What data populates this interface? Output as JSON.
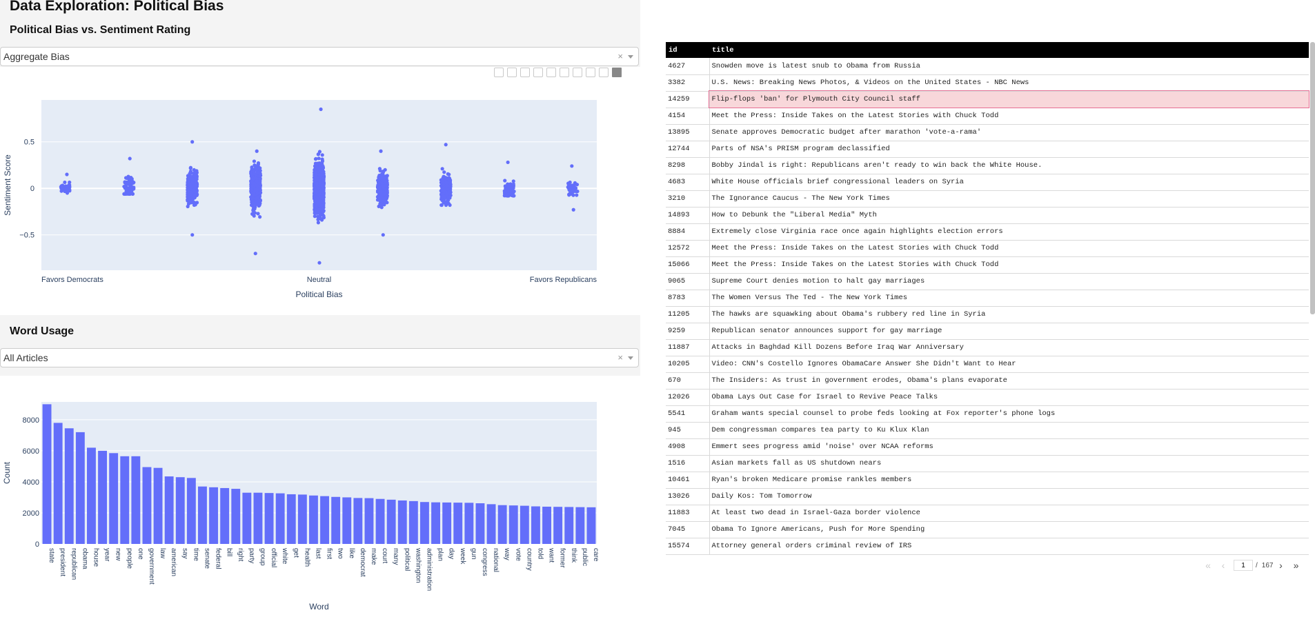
{
  "page_title": "Data Exploration: Political Bias",
  "section1_title": "Political Bias vs. Sentiment Rating",
  "section2_title": "Word Usage",
  "dropdown1": {
    "value": "Aggregate Bias",
    "clear": "×"
  },
  "dropdown2": {
    "value": "All Articles",
    "clear": "×"
  },
  "colors": {
    "marker": "#636efa",
    "plot_bg": "#e5ecf6",
    "header_bg": "#000000",
    "selected_row": "#f8d7da"
  },
  "chart_data": [
    {
      "type": "scatter",
      "title": "",
      "xlabel": "Political Bias",
      "ylabel": "Sentiment Score",
      "x_ticks": [
        "Favors Democrats",
        "Neutral",
        "Favors Republicans"
      ],
      "y_ticks": [
        "0.5",
        "0",
        "−0.5"
      ],
      "ylim": [
        -0.88,
        0.95
      ],
      "grid": true,
      "x_category_count": 9,
      "series": [
        {
          "values": [
            [
              0,
              -0.05,
              0.15
            ],
            [
              1,
              -0.06,
              0.32
            ],
            [
              2,
              -0.5,
              0.5
            ],
            [
              3,
              -0.7,
              0.4
            ],
            [
              4,
              -0.8,
              0.85
            ],
            [
              5,
              -0.5,
              0.4
            ],
            [
              6,
              -0.18,
              0.47
            ],
            [
              7,
              -0.08,
              0.28
            ],
            [
              8,
              -0.23,
              0.24
            ]
          ]
        }
      ]
    },
    {
      "type": "bar",
      "title": "",
      "xlabel": "Word",
      "ylabel": "Count",
      "y_ticks": [
        "0",
        "2000",
        "4000",
        "6000",
        "8000"
      ],
      "ylim": [
        0,
        9150
      ],
      "grid": true,
      "categories": [
        "state",
        "president",
        "republican",
        "obama",
        "house",
        "year",
        "new",
        "people",
        "one",
        "government",
        "law",
        "american",
        "say",
        "time",
        "senate",
        "federal",
        "bill",
        "right",
        "party",
        "group",
        "official",
        "white",
        "get",
        "health",
        "last",
        "first",
        "two",
        "like",
        "democrat",
        "make",
        "court",
        "many",
        "political",
        "washington",
        "administration",
        "plan",
        "day",
        "week",
        "gun",
        "congress",
        "national",
        "way",
        "vote",
        "country",
        "told",
        "want",
        "former",
        "think",
        "public",
        "care"
      ],
      "values": [
        9000,
        7800,
        7450,
        7200,
        6200,
        6000,
        5850,
        5650,
        5650,
        4950,
        4900,
        4350,
        4300,
        4250,
        3700,
        3650,
        3600,
        3550,
        3300,
        3300,
        3280,
        3260,
        3200,
        3180,
        3120,
        3080,
        3030,
        3000,
        2960,
        2950,
        2900,
        2850,
        2800,
        2760,
        2700,
        2680,
        2670,
        2660,
        2650,
        2620,
        2560,
        2500,
        2480,
        2460,
        2420,
        2400,
        2390,
        2380,
        2370,
        2360
      ]
    }
  ],
  "table": {
    "columns": [
      "id",
      "title"
    ],
    "rows": [
      [
        "4627",
        "Snowden move is latest snub to Obama from Russia"
      ],
      [
        "3382",
        "U.S. News: Breaking News Photos, & Videos on the United States - NBC News"
      ],
      [
        "14259",
        "Flip-flops 'ban' for Plymouth City Council staff"
      ],
      [
        "4154",
        "Meet the Press: Inside Takes on the Latest Stories with Chuck Todd"
      ],
      [
        "13895",
        "Senate approves Democratic budget after marathon 'vote-a-rama'"
      ],
      [
        "12744",
        "Parts of NSA's PRISM program declassified"
      ],
      [
        "8298",
        "Bobby Jindal is right: Republicans aren't ready to win back the White House."
      ],
      [
        "4683",
        "White House officials brief congressional leaders on Syria"
      ],
      [
        "3210",
        "The Ignorance Caucus - The New York Times"
      ],
      [
        "14893",
        "How to Debunk the \"Liberal Media\" Myth"
      ],
      [
        "8884",
        "Extremely close Virginia race once again highlights election errors"
      ],
      [
        "12572",
        "Meet the Press: Inside Takes on the Latest Stories with Chuck Todd"
      ],
      [
        "15066",
        "Meet the Press: Inside Takes on the Latest Stories with Chuck Todd"
      ],
      [
        "9065",
        "Supreme Court denies motion to halt gay marriages"
      ],
      [
        "8783",
        "The Women Versus The Ted - The New York Times"
      ],
      [
        "11205",
        "The hawks are squawking about Obama's rubbery red line in Syria"
      ],
      [
        "9259",
        "Republican senator announces support for gay marriage"
      ],
      [
        "11887",
        "Attacks in Baghdad Kill Dozens Before Iraq War Anniversary"
      ],
      [
        "10205",
        "Video: CNN's Costello Ignores ObamaCare Answer She Didn't Want to Hear"
      ],
      [
        "670",
        "The Insiders: As trust in government erodes, Obama's plans evaporate"
      ],
      [
        "12026",
        "Obama Lays Out Case for Israel to Revive Peace Talks"
      ],
      [
        "5541",
        "Graham wants special counsel to probe feds looking at Fox reporter's phone logs"
      ],
      [
        "945",
        "Dem congressman compares tea party to Ku Klux Klan"
      ],
      [
        "4908",
        "Emmert sees progress amid 'noise' over NCAA reforms"
      ],
      [
        "1516",
        "Asian markets fall as US shutdown nears"
      ],
      [
        "10461",
        "Ryan's broken Medicare promise rankles members"
      ],
      [
        "13026",
        "Daily Kos: Tom Tomorrow"
      ],
      [
        "11883",
        "At least two dead in Israel-Gaza border violence"
      ],
      [
        "7045",
        "Obama To Ignore Americans, Push for More Spending"
      ],
      [
        "15574",
        "Attorney general orders criminal review of IRS"
      ]
    ],
    "selected_row": 2
  },
  "pagination": {
    "current": "1",
    "separator": "/",
    "total": "167"
  }
}
